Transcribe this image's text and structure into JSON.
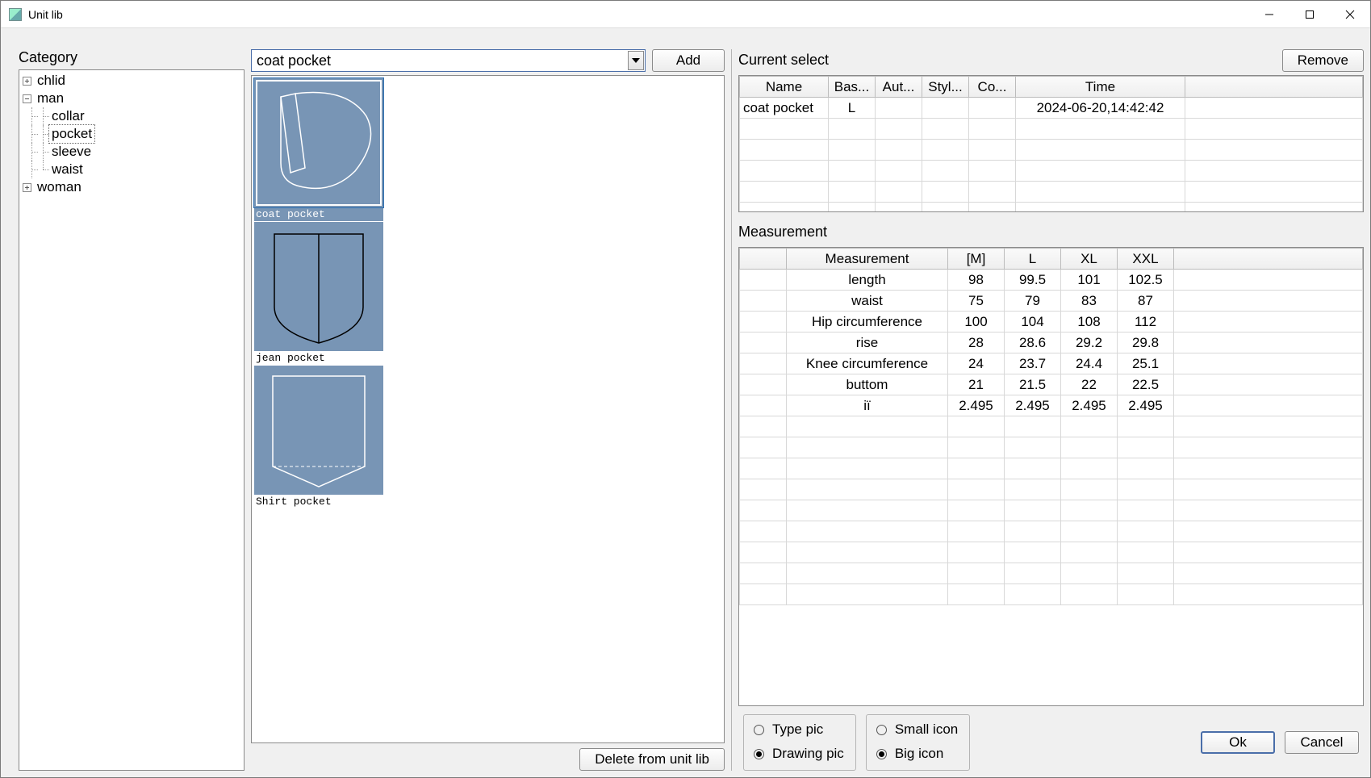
{
  "window": {
    "title": "Unit lib"
  },
  "left": {
    "category_label": "Category"
  },
  "tree": {
    "n0": "chlid",
    "n1": "man",
    "n1_0": "collar",
    "n1_1": "pocket",
    "n1_2": "sleeve",
    "n1_3": "waist",
    "n2": "woman"
  },
  "mid": {
    "combo_value": "coat pocket",
    "add_label": "Add",
    "delete_label": "Delete from unit lib",
    "thumbs": [
      {
        "name": "coat pocket",
        "selected": true
      },
      {
        "name": "jean pocket",
        "selected": false
      },
      {
        "name": "Shirt pocket",
        "selected": false
      }
    ]
  },
  "right": {
    "current_select_label": "Current select",
    "remove_label": "Remove",
    "measurement_label": "Measurement",
    "sel_headers": [
      "Name",
      "Bas...",
      "Aut...",
      "Styl...",
      "Co...",
      "Time",
      ""
    ],
    "sel_row": {
      "name": "coat pocket",
      "base": "L",
      "aut": "",
      "styl": "",
      "co": "",
      "time": "2024-06-20,14:42:42",
      "extra": ""
    },
    "meas_headers": [
      "",
      "Measurement",
      "[M]",
      "L",
      "XL",
      "XXL",
      ""
    ],
    "meas_rows": [
      [
        "",
        "length",
        "98",
        "99.5",
        "101",
        "102.5",
        ""
      ],
      [
        "",
        "waist",
        "75",
        "79",
        "83",
        "87",
        ""
      ],
      [
        "",
        "Hip circumference",
        "100",
        "104",
        "108",
        "112",
        ""
      ],
      [
        "",
        "rise",
        "28",
        "28.6",
        "29.2",
        "29.8",
        ""
      ],
      [
        "",
        "Knee circumference",
        "24",
        "23.7",
        "24.4",
        "25.1",
        ""
      ],
      [
        "",
        "buttom",
        "21",
        "21.5",
        "22",
        "22.5",
        ""
      ],
      [
        "",
        "iï",
        "2.495",
        "2.495",
        "2.495",
        "2.495",
        ""
      ]
    ],
    "radios": {
      "pic_group": {
        "type_pic": "Type pic",
        "drawing_pic": "Drawing pic",
        "selected": "drawing_pic"
      },
      "icon_group": {
        "small_icon": "Small icon",
        "big_icon": "Big icon",
        "selected": "big_icon"
      }
    },
    "ok_label": "Ok",
    "cancel_label": "Cancel"
  }
}
